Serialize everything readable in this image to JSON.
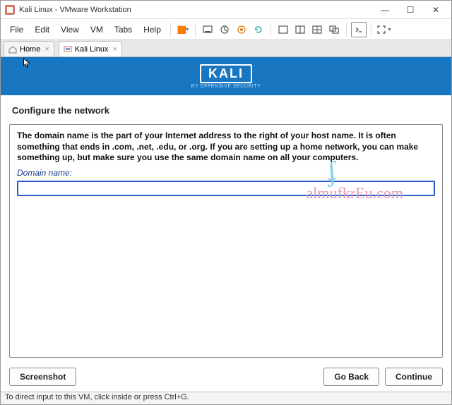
{
  "window": {
    "title": "Kali Linux - VMware Workstation"
  },
  "menu": {
    "file": "File",
    "edit": "Edit",
    "view": "View",
    "vm": "VM",
    "tabs": "Tabs",
    "help": "Help"
  },
  "tabs": {
    "home": "Home",
    "kali": "Kali Linux"
  },
  "banner": {
    "logo": "KALI",
    "subtitle": "BY OFFENSIVE SECURITY"
  },
  "installer": {
    "section_title": "Configure the network",
    "description": "The domain name is the part of your Internet address to the right of your host name.  It is often something that ends in .com, .net, .edu, or .org.  If you are setting up a home network, you can make something up, but make sure you use the same domain name on all your computers.",
    "field_label": "Domain name:",
    "domain_value": ""
  },
  "buttons": {
    "screenshot": "Screenshot",
    "go_back": "Go Back",
    "continue": "Continue"
  },
  "watermark": {
    "text": "almufkrEu.com"
  },
  "statusbar": {
    "hint": "To direct input to this VM, click inside or press Ctrl+G."
  }
}
